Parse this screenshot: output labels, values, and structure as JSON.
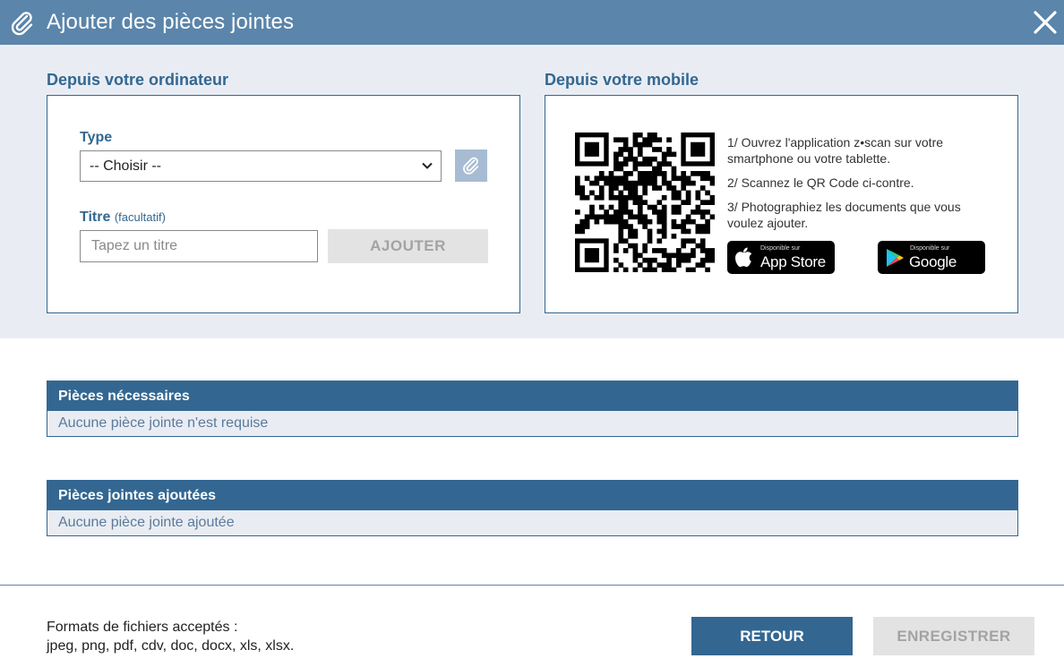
{
  "dialog": {
    "title": "Ajouter des pièces jointes",
    "close_icon": "close-icon",
    "header_icon": "paperclip-icon",
    "header_color": "#5b85aa"
  },
  "computer": {
    "section_title": "Depuis votre ordinateur",
    "type_label": "Type",
    "type_selected": "-- Choisir --",
    "titre_label": "Titre",
    "titre_optional": "(facultatif)",
    "titre_placeholder": "Tapez un titre",
    "add_button": "AJOUTER"
  },
  "mobile": {
    "section_title": "Depuis votre mobile",
    "steps": [
      "1/ Ouvrez l'application z•scan sur votre smartphone ou votre tablette.",
      "2/ Scannez le QR Code ci-contre.",
      "3/ Photographiez les documents que vous voulez ajouter."
    ],
    "app_store": {
      "small": "Disponible sur",
      "big": "App Store"
    },
    "google_play": {
      "small": "Disponible sur",
      "big": "Google Play"
    }
  },
  "required": {
    "header": "Pièces nécessaires",
    "empty": "Aucune pièce jointe n'est requise"
  },
  "added": {
    "header": "Pièces jointes ajoutées",
    "empty": "Aucune pièce jointe ajoutée"
  },
  "footer": {
    "formats_label": "Formats de fichiers acceptés :",
    "formats_list": "jpeg, png, pdf, cdv, doc, docx, xls, xlsx.",
    "back_button": "RETOUR",
    "save_button": "ENREGISTRER"
  },
  "colors": {
    "primary": "#336791",
    "header": "#5b85aa",
    "panel_bg": "#e9edf3",
    "disabled_bg": "#e3e3e3",
    "disabled_text": "#a3a3a3"
  }
}
